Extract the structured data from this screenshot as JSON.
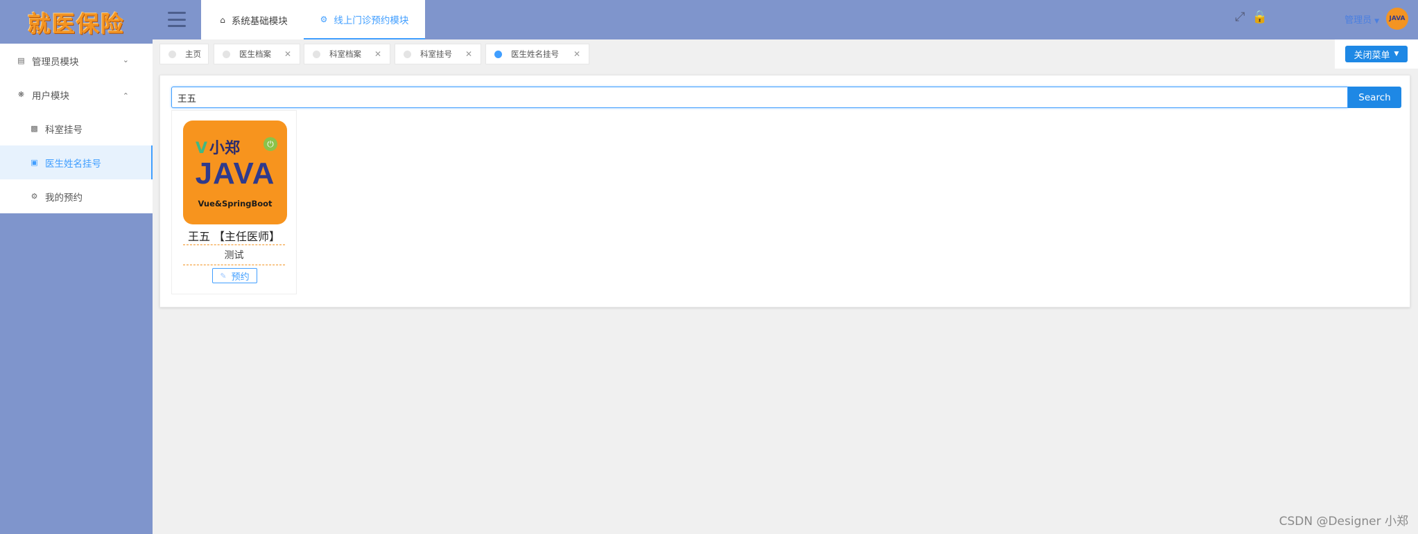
{
  "sidebar": {
    "logo": "就医保险",
    "items": [
      {
        "label": "管理员模块",
        "icon": "bed-icon",
        "expand": "chevron-down"
      },
      {
        "label": "用户模块",
        "icon": "bug-icon",
        "expand": "chevron-up"
      },
      {
        "label": "科室挂号",
        "icon": "chat-icon"
      },
      {
        "label": "医生姓名挂号",
        "icon": "card-icon",
        "active": true
      },
      {
        "label": "我的预约",
        "icon": "dashboard-icon"
      }
    ]
  },
  "header": {
    "tabs": [
      {
        "label": "系统基础模块",
        "icon": "home-icon"
      },
      {
        "label": "线上门诊预约模块",
        "icon": "settings-icon",
        "active": true
      }
    ],
    "user": "管理员",
    "avatar_text": "JAVA"
  },
  "tags": [
    {
      "label": "主页"
    },
    {
      "label": "医生档案"
    },
    {
      "label": "科室档案"
    },
    {
      "label": "科室挂号"
    },
    {
      "label": "医生姓名挂号",
      "active": true
    }
  ],
  "close_menu": "关闭菜单",
  "search": {
    "value": "王五",
    "button": "Search"
  },
  "doctor_card": {
    "image": {
      "line1": "小郑",
      "line2": "JAVA",
      "line3": "Vue&SpringBoot"
    },
    "name": "王五 【主任医师】",
    "department": "测试",
    "book_label": "预约"
  },
  "watermark": "CSDN @Designer 小郑",
  "colors": {
    "sidebar": "#7f95cc",
    "accent": "#409eff",
    "button": "#1e88e5",
    "orange": "#f39422"
  }
}
